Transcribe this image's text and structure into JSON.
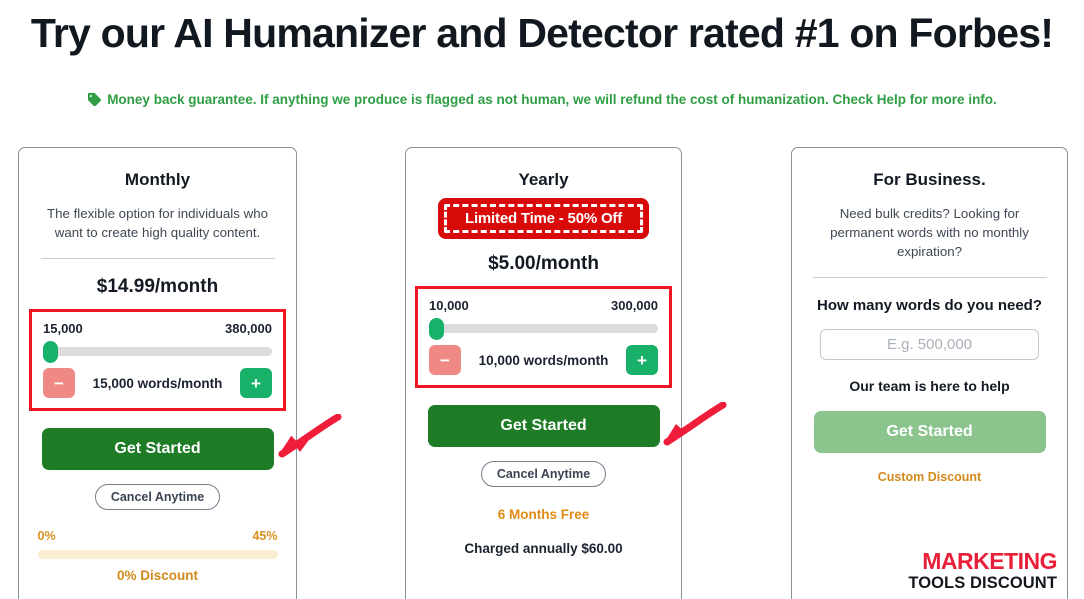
{
  "header": {
    "headline": "Try our AI Humanizer and Detector rated #1 on Forbes!",
    "guarantee": "Money back guarantee. If anything we produce is flagged as not human, we will refund the cost of humanization. Check Help for more info.",
    "guarantee_icon": "tag-icon",
    "guarantee_color": "#2f9e44"
  },
  "colors": {
    "primary_green": "#1e7b26",
    "slider_green": "#17b169",
    "minus_red": "#ef8983",
    "annotation_red": "#ef1421",
    "badge_red": "#d80a0a",
    "discount_orange": "#d28a1a",
    "muted_green": "#8bc48d"
  },
  "plans": {
    "monthly": {
      "title": "Monthly",
      "description": "The flexible option for individuals who want to create high quality content.",
      "price": "$14.99/month",
      "slider": {
        "min_label": "15,000",
        "max_label": "380,000",
        "value_label": "15,000 words/month",
        "minus_label": "−",
        "plus_label": "+",
        "fill_percent": 0
      },
      "cta_label": "Get Started",
      "cancel_label": "Cancel Anytime",
      "discount": {
        "min_label": "0%",
        "max_label": "45%",
        "current_label": "0% Discount",
        "fill_percent": 0
      }
    },
    "yearly": {
      "title": "Yearly",
      "badge_label": "Limited Time - 50% Off",
      "price": "$5.00/month",
      "slider": {
        "min_label": "10,000",
        "max_label": "300,000",
        "value_label": "10,000 words/month",
        "minus_label": "−",
        "plus_label": "+",
        "fill_percent": 0
      },
      "cta_label": "Get Started",
      "cancel_label": "Cancel Anytime",
      "free_months_label": "6 Months Free",
      "charged_label": "Charged annually $60.00"
    },
    "business": {
      "title": "For Business.",
      "description": "Need bulk credits? Looking for permanent words with no monthly expiration?",
      "question_label": "How many words do you need?",
      "input_value": "",
      "input_placeholder": "E.g. 500,000",
      "help_label": "Our team is here to help",
      "cta_label": "Get Started",
      "custom_discount_label": "Custom Discount",
      "logo": {
        "line1": "MARKETING",
        "line2": "TOOLS DISCOUNT"
      }
    }
  },
  "annotations": {
    "arrow1_name": "arrow-pointing-monthly-get-started",
    "arrow2_name": "arrow-pointing-yearly-get-started"
  }
}
